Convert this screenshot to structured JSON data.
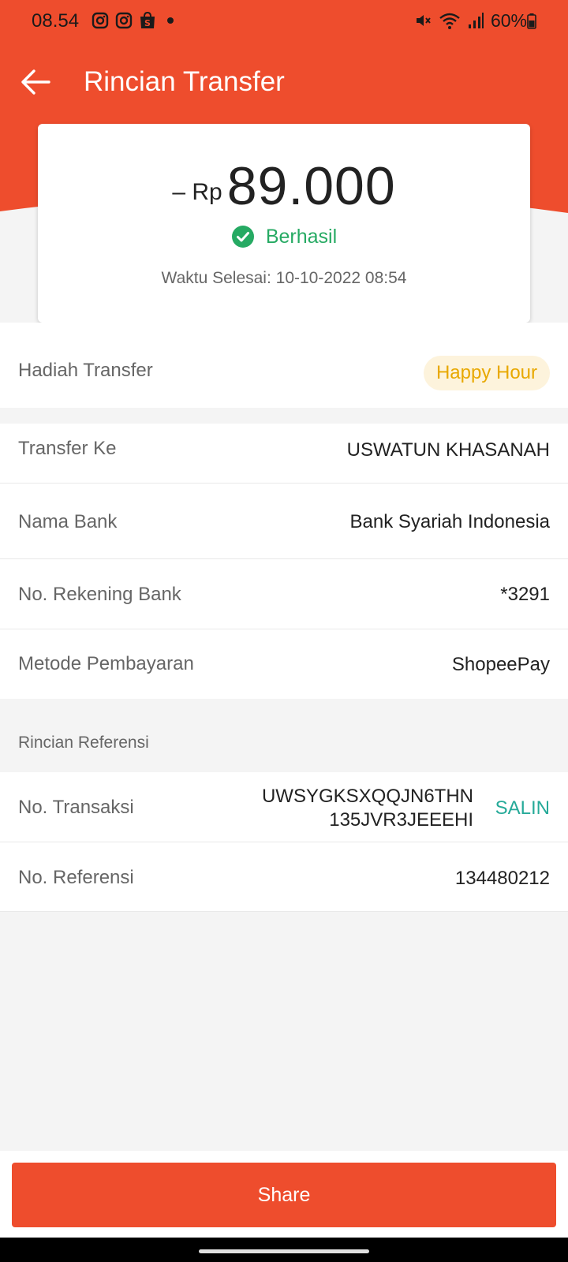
{
  "status_bar": {
    "time": "08.54",
    "battery": "60%",
    "left_icons": [
      "instagram-icon",
      "instagram-icon",
      "shopee-icon",
      "dot-icon"
    ],
    "right_icons": [
      "mute-icon",
      "wifi-icon",
      "signal-icon",
      "battery-icon"
    ]
  },
  "header": {
    "title": "Rincian Transfer",
    "color": "#ee4d2d"
  },
  "summary": {
    "prefix": "– Rp",
    "amount": "89.000",
    "status": "Berhasil",
    "status_color": "#26aa63",
    "completed_at": "Waktu Selesai: 10-10-2022 08:54"
  },
  "reward": {
    "label": "Hadiah Transfer",
    "badge": "Happy Hour"
  },
  "details": [
    {
      "label": "Transfer Ke",
      "value": "USWATUN KHASANAH"
    },
    {
      "label": "Nama Bank",
      "value": "Bank Syariah Indonesia"
    },
    {
      "label": "No. Rekening Bank",
      "value": "*3291"
    },
    {
      "label": "Metode Pembayaran",
      "value": "ShopeePay"
    }
  ],
  "reference": {
    "section_title": "Rincian Referensi",
    "transaction_label": "No. Transaksi",
    "transaction_value": "UWSYGKSXQQJN6THN135JVR3JEEEHI",
    "copy_label": "SALIN",
    "reference_label": "No. Referensi",
    "reference_value": "134480212"
  },
  "footer": {
    "share_label": "Share"
  }
}
